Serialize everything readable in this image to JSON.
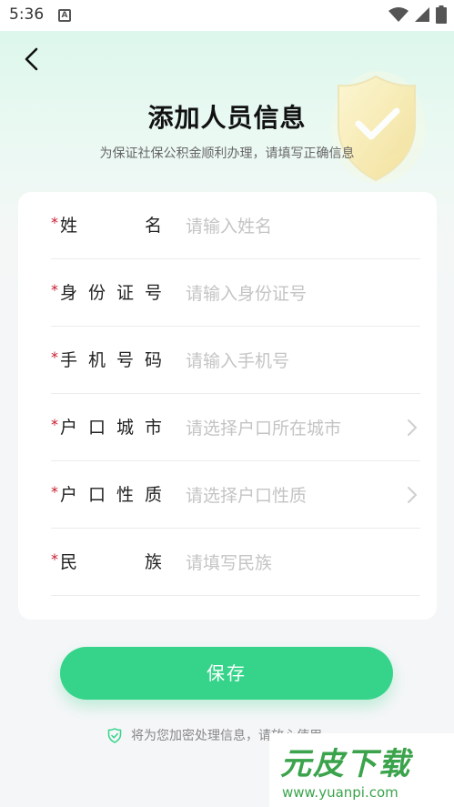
{
  "status_bar": {
    "time": "5:36",
    "notification_badge": "A",
    "icons": [
      "wifi-icon",
      "signal-icon",
      "battery-icon"
    ]
  },
  "header": {
    "title": "添加人员信息",
    "subtitle": "为保证社保公积金顺利办理，请填写正确信息"
  },
  "form": {
    "required_mark": "*",
    "fields": [
      {
        "label_parts": [
          "姓",
          "名"
        ],
        "placeholder": "请输入姓名",
        "type": "input"
      },
      {
        "label_parts": [
          "身",
          "份",
          "证",
          "号"
        ],
        "placeholder": "请输入身份证号",
        "type": "input"
      },
      {
        "label_parts": [
          "手",
          "机",
          "号",
          "码"
        ],
        "placeholder": "请输入手机号",
        "type": "input"
      },
      {
        "label_parts": [
          "户",
          "口",
          "城",
          "市"
        ],
        "placeholder": "请选择户口所在城市",
        "type": "select"
      },
      {
        "label_parts": [
          "户",
          "口",
          "性",
          "质"
        ],
        "placeholder": "请选择户口性质",
        "type": "select"
      },
      {
        "label_parts": [
          "民",
          "族"
        ],
        "placeholder": "请填写民族",
        "type": "input"
      }
    ]
  },
  "actions": {
    "save_label": "保存"
  },
  "footer": {
    "secure_note": "将为您加密处理信息，请放心使用"
  },
  "watermark": {
    "logo_text": "元皮下载",
    "url": "www.yuanpi.com"
  },
  "colors": {
    "accent": "#36d48a",
    "required": "#c61b2e",
    "placeholder": "#c4c4c4"
  }
}
